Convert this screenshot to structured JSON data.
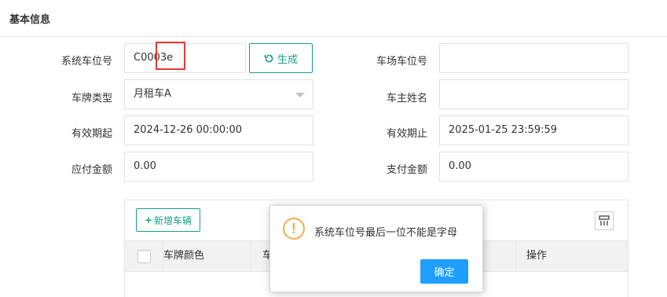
{
  "section": {
    "title": "基本信息"
  },
  "form": {
    "system_slot": {
      "label": "系统车位号",
      "value": "C0003e"
    },
    "generate_button": {
      "label": "生成"
    },
    "lot_slot": {
      "label": "车场车位号",
      "value": ""
    },
    "plate_type": {
      "label": "车牌类型",
      "value": "月租车A"
    },
    "owner_name": {
      "label": "车主姓名",
      "value": ""
    },
    "valid_from": {
      "label": "有效期起",
      "value": "2024-12-26 00:00:00"
    },
    "valid_to": {
      "label": "有效期止",
      "value": "2025-01-25 23:59:59"
    },
    "amount_due": {
      "label": "应付金额",
      "value": "0.00"
    },
    "amount_paid": {
      "label": "支付金额",
      "value": "0.00"
    }
  },
  "table": {
    "add_button": "新增车辆",
    "columns": [
      "车牌颜色",
      "车",
      "操作"
    ]
  },
  "dialog": {
    "icon": "warning-icon",
    "message": "系统车位号最后一位不能是字母",
    "ok_label": "确定"
  },
  "colors": {
    "accent_green": "#16a085",
    "primary_blue": "#1e9fff",
    "warning_orange": "#f0ad4e",
    "highlight_red": "#e53935"
  }
}
